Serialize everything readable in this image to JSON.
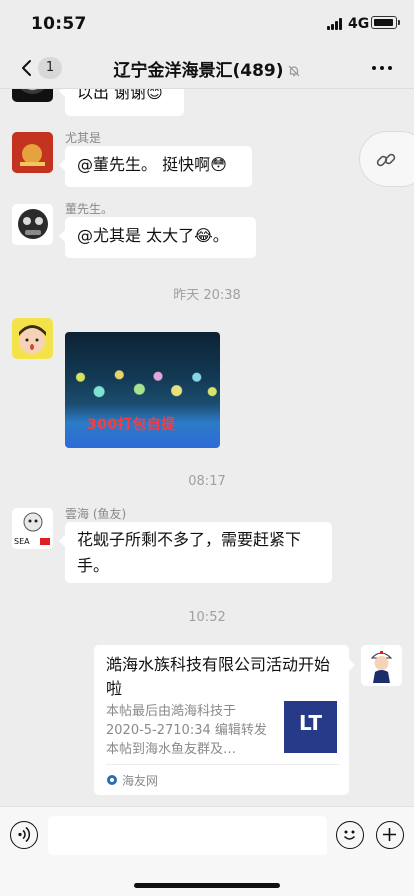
{
  "status_bar": {
    "time": "10:57",
    "network": "4G",
    "icons": [
      "signal-bars-icon",
      "battery-icon"
    ]
  },
  "header": {
    "back_icon": "chevron-left-icon",
    "unread_count": "1",
    "title": "辽宁金洋海景汇(489)",
    "mute_icon": "bell-off-icon",
    "more_icon": "ellipsis-icon"
  },
  "messages": [
    {
      "type": "text",
      "side": "left",
      "sender": "",
      "text": "以出 谢谢😊"
    },
    {
      "type": "text",
      "side": "left",
      "sender": "尤其是",
      "text": "@董先生。 挺快啊😳"
    },
    {
      "type": "text",
      "side": "left",
      "sender": "董先生。",
      "text": "@尤其是  太大了😂。"
    },
    {
      "type": "time",
      "text": "昨天 20:38"
    },
    {
      "type": "image",
      "side": "left",
      "caption": "300打包自提"
    },
    {
      "type": "time",
      "text": "08:17"
    },
    {
      "type": "text",
      "side": "left",
      "sender": "雲海 (鱼友)",
      "text": "花蚬子所剩不多了，需要赶紧下手。"
    },
    {
      "type": "time",
      "text": "10:52"
    },
    {
      "type": "link_card",
      "side": "right",
      "title": "澔海水族科技有限公司活动开始啦",
      "description": "本帖最后由澔海科技于 2020-5-2710:34 编辑转发本帖到海水鱼友群及…",
      "source": "海友网",
      "source_icon": "site-logo-icon",
      "thumbnail_text": "LT"
    }
  ],
  "float_button": {
    "icon": "link-icon"
  },
  "input_bar": {
    "voice_icon": "voice-icon",
    "emoji_icon": "emoji-icon",
    "plus_icon": "plus-icon",
    "placeholder": ""
  },
  "colors": {
    "background": "#ededed",
    "bubble": "#ffffff",
    "meta_text": "#a0a0a0",
    "image_caption": "#ff3a3a"
  }
}
